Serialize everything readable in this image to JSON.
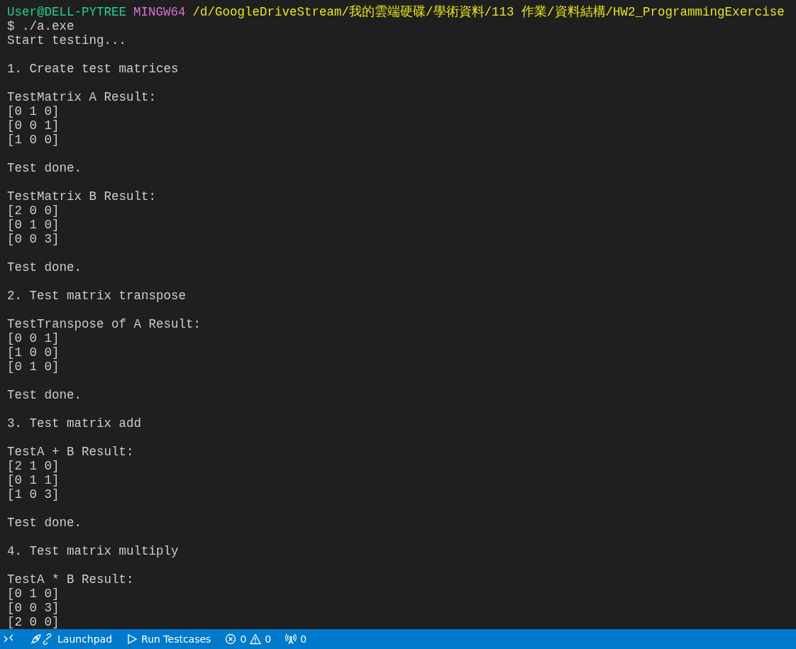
{
  "terminal": {
    "prompt": {
      "user": "User@DELL-PYTREE",
      "system": "MINGW64",
      "path": "/d/GoogleDriveStream/我的雲端硬碟/學術資料/113 作業/資料結構/HW2_ProgrammingExercise"
    },
    "blocks": [
      [
        "$ ./a.exe",
        "Start testing..."
      ],
      [
        "1. Create test matrices"
      ],
      [
        "TestMatrix A Result:",
        "[0 1 0]",
        "[0 0 1]",
        "[1 0 0]"
      ],
      [
        "Test done."
      ],
      [
        "TestMatrix B Result:",
        "[2 0 0]",
        "[0 1 0]",
        "[0 0 3]"
      ],
      [
        "Test done."
      ],
      [
        "2. Test matrix transpose"
      ],
      [
        "TestTranspose of A Result:",
        "[0 0 1]",
        "[1 0 0]",
        "[0 1 0]"
      ],
      [
        "Test done."
      ],
      [
        "3. Test matrix add"
      ],
      [
        "TestA + B Result:",
        "[2 1 0]",
        "[0 1 1]",
        "[1 0 3]"
      ],
      [
        "Test done."
      ],
      [
        "4. Test matrix multiply"
      ],
      [
        "TestA * B Result:",
        "[0 1 0]",
        "[0 0 3]",
        "[2 0 0]"
      ]
    ]
  },
  "status_bar": {
    "items": [
      {
        "kind": "remote"
      },
      {
        "kind": "launchpad",
        "label": "Launchpad"
      },
      {
        "kind": "run",
        "label": "Run Testcases"
      },
      {
        "kind": "problems",
        "errors": "0",
        "warnings": "0"
      },
      {
        "kind": "ports",
        "label": "0"
      }
    ]
  }
}
